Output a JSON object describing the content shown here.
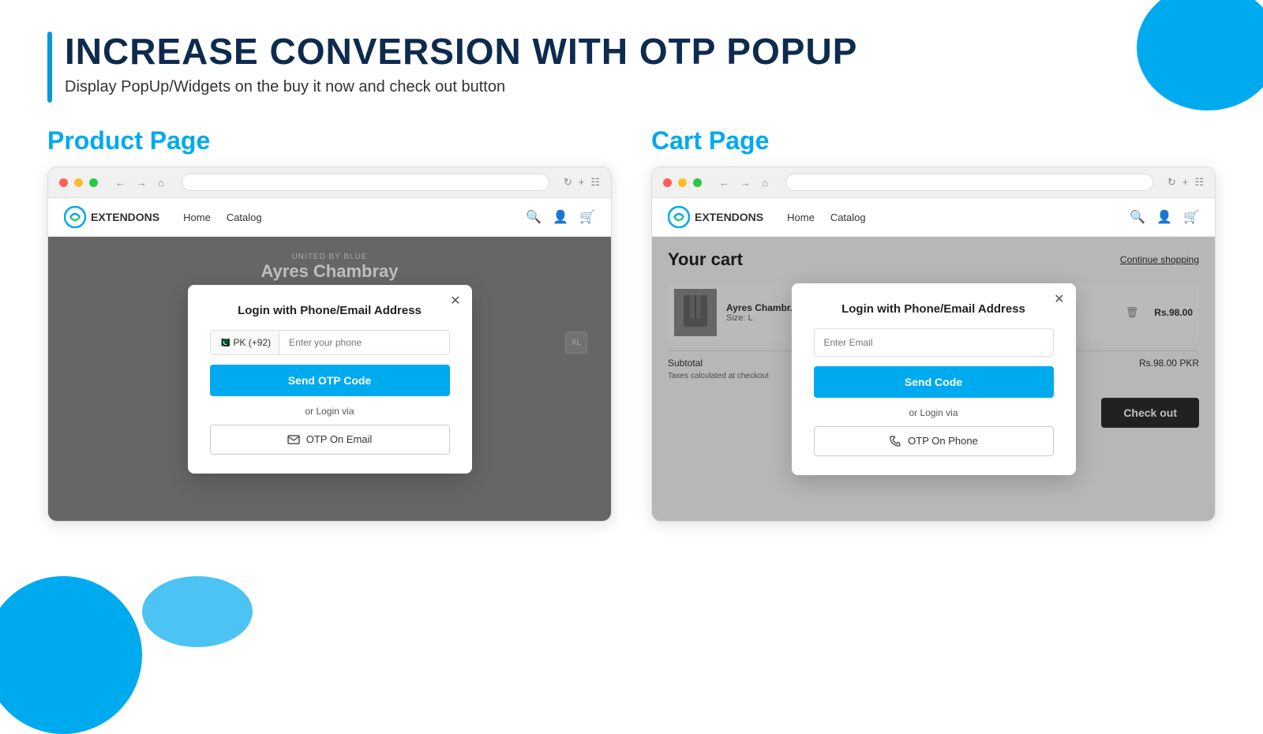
{
  "header": {
    "title": "INCREASE CONVERSION WITH OTP POPUP",
    "subtitle": "Display PopUp/Widgets on the buy it now and check out button"
  },
  "product_section": {
    "label": "Product Page",
    "browser": {
      "dots": [
        "red",
        "yellow",
        "green"
      ],
      "nav_arrows": [
        "←",
        "→",
        "↺"
      ],
      "search_placeholder": "",
      "address": ""
    },
    "store": {
      "logo_text": "EXTENDONS",
      "nav_links": [
        "Home",
        "Catalog"
      ]
    },
    "product": {
      "subtitle": "UNITED BY BLUE",
      "title": "Ayres Chambray"
    },
    "popup": {
      "title": "Login with Phone/Email Address",
      "phone_flag": "🇵🇰",
      "phone_code": "PK (+92)",
      "phone_placeholder": "Enter your phone",
      "send_btn": "Send OTP Code",
      "or_text": "or Login via",
      "alt_btn": "OTP On Email",
      "alt_icon": "email-icon"
    }
  },
  "cart_section": {
    "label": "Cart Page",
    "browser": {
      "dots": [
        "red",
        "yellow",
        "green"
      ]
    },
    "store": {
      "logo_text": "EXTENDONS",
      "nav_links": [
        "Home",
        "Catalog"
      ]
    },
    "cart": {
      "title": "Your cart",
      "continue_shopping": "Continue shopping",
      "item_name": "Ayres Chambr...",
      "item_size": "Size: L",
      "item_price": "Rs.98.00",
      "subtotal_label": "Subtotal",
      "subtotal_value": "Rs.98.00 PKR",
      "tax_note": "Taxes calculated at checkout",
      "checkout_btn": "Check out"
    },
    "popup": {
      "title": "Login with Phone/Email Address",
      "email_placeholder": "Enter Email",
      "send_btn": "Send Code",
      "or_text": "or Login via",
      "alt_btn": "OTP On Phone",
      "alt_icon": "phone-icon"
    }
  },
  "colors": {
    "accent": "#00aaee",
    "dark_heading": "#0d2b4e",
    "checkout_dark": "#2c2c2c"
  }
}
